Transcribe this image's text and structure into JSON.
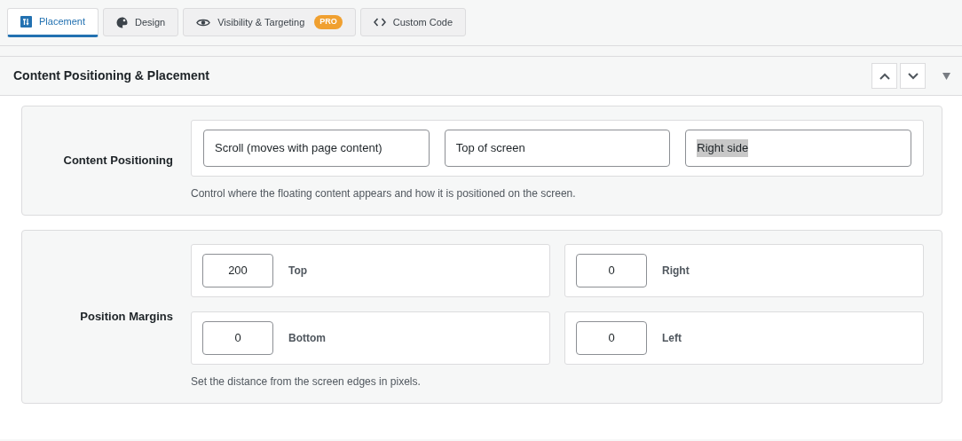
{
  "tabs": [
    {
      "label": "Placement",
      "kind": "placement",
      "selected": true
    },
    {
      "label": "Design",
      "kind": "palette",
      "selected": false
    },
    {
      "label": "Visibility & Targeting",
      "kind": "eye",
      "badge": "PRO",
      "selected": false
    },
    {
      "label": "Custom Code",
      "kind": "code",
      "selected": false
    }
  ],
  "panel": {
    "title": "Content Positioning & Placement",
    "sections": [
      {
        "kind": "choices",
        "label": "Content Positioning",
        "options": [
          {
            "value": "Scroll (moves with page content)",
            "highlighted": false
          },
          {
            "value": "Top of screen",
            "highlighted": false
          },
          {
            "value": "Right side",
            "highlighted": true
          }
        ],
        "help": "Control where the floating content appears and how it is positioned on the screen."
      },
      {
        "kind": "margins",
        "label": "Position Margins",
        "fields": [
          {
            "amount": "200",
            "side": "Top"
          },
          {
            "amount": "0",
            "side": "Right"
          },
          {
            "amount": "0",
            "side": "Bottom"
          },
          {
            "amount": "0",
            "side": "Left"
          }
        ],
        "help": "Set the distance from the screen edges in pixels."
      }
    ]
  }
}
